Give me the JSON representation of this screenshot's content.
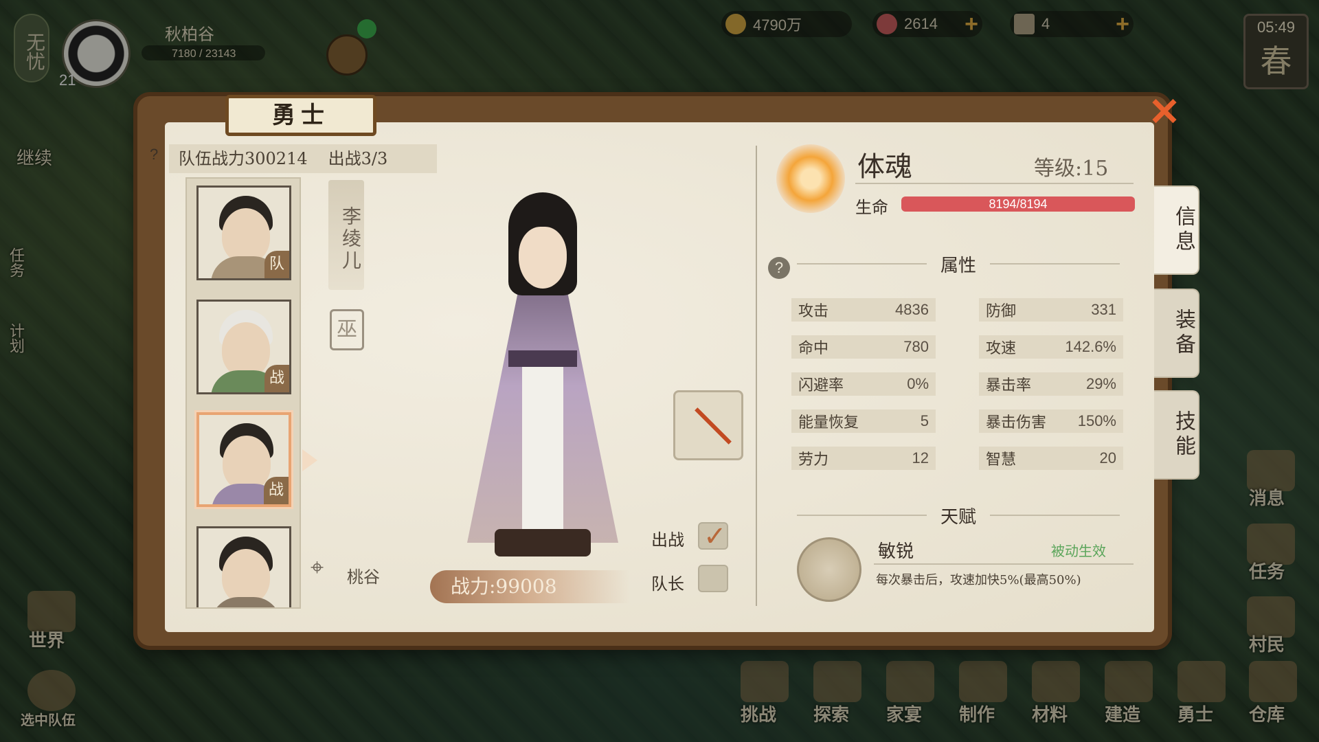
{
  "hud": {
    "season_tag": "无忧",
    "player_name": "秋柏谷",
    "player_level": "21",
    "player_exp": "7180 / 23143",
    "resources": {
      "gold": "4790万",
      "gems": "2614",
      "tickets": "4"
    },
    "clock": {
      "time": "05:49",
      "season": "春"
    }
  },
  "left_sidebar": {
    "continue": "继续",
    "task": "任务",
    "plan": "计划",
    "world": "世界",
    "selected_team": "选中队伍"
  },
  "bottom_bar": [
    "挑战",
    "探索",
    "家宴",
    "制作",
    "材料",
    "建造",
    "勇士",
    "仓库"
  ],
  "right_sidebar": {
    "messages": "消息",
    "tasks": "任务",
    "villagers": "村民"
  },
  "panel": {
    "title": "勇士",
    "team_help": "?",
    "team_power": "队伍战力300214",
    "deploy_count": "出战3/3",
    "roster": [
      {
        "tag": "队"
      },
      {
        "tag": "战"
      },
      {
        "tag": "战"
      },
      {
        "tag": ""
      }
    ],
    "character_name": "李绫儿",
    "stamp": "巫",
    "location": "桃谷",
    "combat_power": "战力:99008",
    "deploy_label": "出战",
    "deploy_checked": true,
    "captain_label": "队长",
    "captain_checked": false
  },
  "info": {
    "spirit": "体魂",
    "level": "等级:15",
    "hp_label": "生命",
    "hp_text": "8194/8194",
    "hp_fraction": 1.0,
    "attributes_title": "属性",
    "attributes": [
      {
        "name": "攻击",
        "value": "4836"
      },
      {
        "name": "防御",
        "value": "331"
      },
      {
        "name": "命中",
        "value": "780"
      },
      {
        "name": "攻速",
        "value": "142.6%"
      },
      {
        "name": "闪避率",
        "value": "0%"
      },
      {
        "name": "暴击率",
        "value": "29%"
      },
      {
        "name": "能量恢复",
        "value": "5"
      },
      {
        "name": "暴击伤害",
        "value": "150%"
      },
      {
        "name": "劳力",
        "value": "12"
      },
      {
        "name": "智慧",
        "value": "20"
      }
    ],
    "talent_title": "天赋",
    "talent_name": "敏锐",
    "talent_status": "被动生效",
    "talent_desc": "每次暴击后，攻速加快5%(最高50%)"
  },
  "tabs": [
    "信息",
    "装备",
    "技能"
  ],
  "colors": {
    "hp_bar": "#d9575a",
    "talent_status": "#5aa55a",
    "close": "#e8602c",
    "gold_plus": "#d8a640"
  },
  "icons": {
    "close": "close-x-icon",
    "location": "location-pin-icon",
    "help": "question-icon",
    "spirit": "plum-blossom-icon",
    "talent": "running-figure-icon",
    "weapon": "spear-icon"
  }
}
